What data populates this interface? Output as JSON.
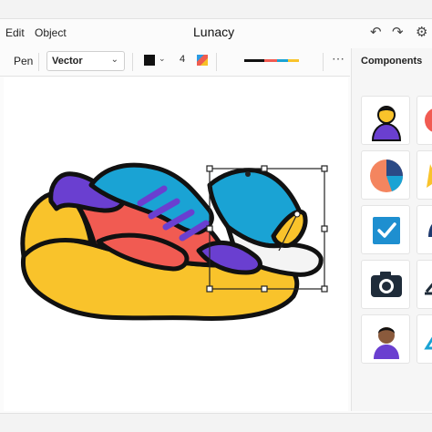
{
  "menu": {
    "items": [
      "Edit",
      "Object"
    ]
  },
  "app": {
    "title": "Lunacy"
  },
  "toolbar": {
    "tool_label": "Pen",
    "type_value": "Vector",
    "stroke_color": "#111111",
    "stroke_width": "4"
  },
  "panel": {
    "title": "Components"
  },
  "components": [
    {
      "icon": "user-avatar-icon"
    },
    {
      "icon": "pie-chart-icon"
    },
    {
      "icon": "checkbox-checked-icon"
    },
    {
      "icon": "camera-icon"
    },
    {
      "icon": "person-avatar-icon"
    }
  ],
  "colors": {
    "accent_red": "#f15b52",
    "accent_blue": "#1aa3d4",
    "accent_purple": "#6a3fd0",
    "accent_yellow": "#f9c32b",
    "outline": "#111111",
    "selection": "#222222"
  }
}
